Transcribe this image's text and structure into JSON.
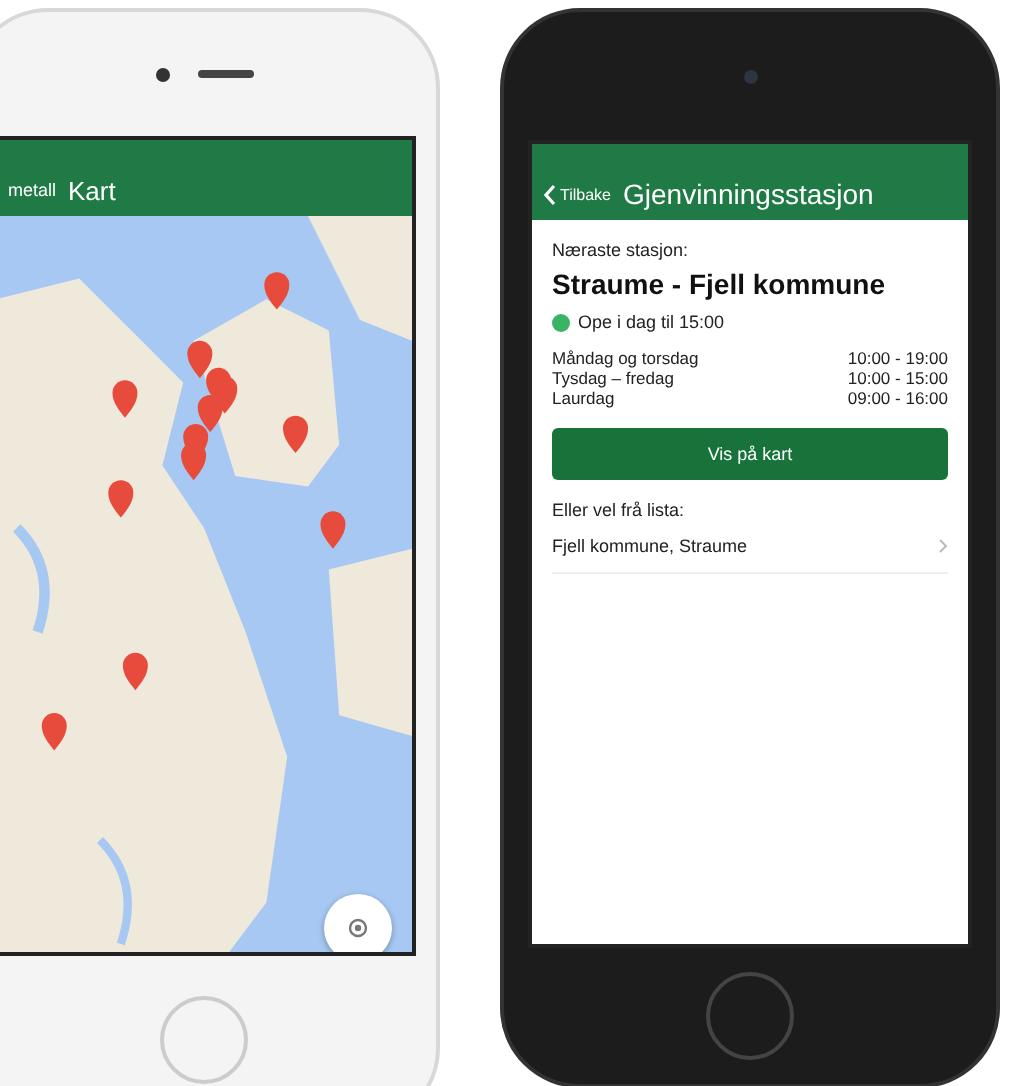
{
  "map_phone": {
    "header": {
      "back": "metall",
      "title": "Kart"
    }
  },
  "station_phone": {
    "header": {
      "back": "Tilbake",
      "title": "Gjenvinningsstasjon"
    },
    "nearest_label": "Næraste stasjon:",
    "station": "Straume - Fjell kommune",
    "status": {
      "text": "Ope i dag til 15:00",
      "open": true
    },
    "hours": [
      {
        "days": "Måndag og torsdag",
        "time": "10:00 - 19:00"
      },
      {
        "days": "Tysdag – fredag",
        "time": "10:00 - 15:00"
      },
      {
        "days": "Laurdag",
        "time": "09:00 - 16:00"
      }
    ],
    "button": "Vis på kart",
    "list_label": "Eller vel frå lista:",
    "list": [
      "Fjell kommune, Straume"
    ]
  }
}
